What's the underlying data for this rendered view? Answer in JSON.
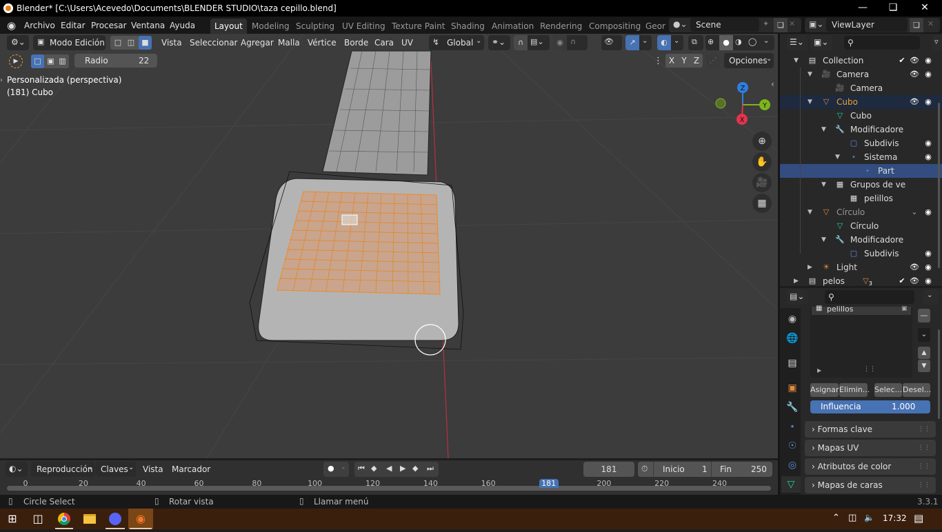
{
  "window": {
    "title": "Blender* [C:\\Users\\Acevedo\\Documents\\BLENDER STUDIO\\taza cepillo.blend]",
    "controls": [
      "minimize",
      "maximize",
      "close"
    ]
  },
  "menubar": {
    "menus": [
      "Archivo",
      "Editar",
      "Procesar",
      "Ventana",
      "Ayuda"
    ],
    "workspaces": [
      "Layout",
      "Modeling",
      "Sculpting",
      "UV Editing",
      "Texture Paint",
      "Shading",
      "Animation",
      "Rendering",
      "Compositing",
      "Geor"
    ],
    "active_workspace": "Layout",
    "scene": "Scene",
    "view_layer": "ViewLayer"
  },
  "viewport_header": {
    "mode": "Modo Edición",
    "menus": [
      "Vista",
      "Seleccionar",
      "Agregar",
      "Malla",
      "Vértice",
      "Borde",
      "Cara",
      "UV"
    ],
    "orientation": "Global",
    "axes": [
      "X",
      "Y",
      "Z"
    ],
    "options_label": "Opciones"
  },
  "tool_settings": {
    "radius_label": "Radio",
    "radius_value": "22"
  },
  "viewport": {
    "view_name": "Personalizada (perspectiva)",
    "object_info": "(181) Cubo",
    "gizmo_axes": {
      "z": "Z",
      "y": "Y",
      "x": "X"
    },
    "colors": {
      "x": "#e4344c",
      "y": "#7db61b",
      "z": "#2e7fe0",
      "selection": "#f08a24"
    }
  },
  "outliner": {
    "search_placeholder": "",
    "rows": [
      {
        "label": "Collection",
        "icon": "collection-icon",
        "level": 0,
        "expanded": true
      },
      {
        "label": "Camera",
        "icon": "camera-object-icon",
        "level": 1,
        "expanded": true
      },
      {
        "label": "Camera",
        "icon": "camera-data-icon",
        "level": 2
      },
      {
        "label": "Cubo",
        "icon": "mesh-object-icon",
        "level": 1,
        "expanded": true,
        "active": true
      },
      {
        "label": "Cubo",
        "icon": "mesh-data-icon",
        "level": 2
      },
      {
        "label": "Modificadore",
        "icon": "wrench-icon",
        "level": 2,
        "expanded": true
      },
      {
        "label": "Subdivis",
        "icon": "subdivision-icon",
        "level": 3
      },
      {
        "label": "Sistema",
        "icon": "particles-icon",
        "level": 3,
        "expanded": true
      },
      {
        "label": "Part",
        "icon": "particle-settings-icon",
        "level": 4,
        "selected": true
      },
      {
        "label": "Grupos de ve",
        "icon": "vertex-groups-icon",
        "level": 2,
        "expanded": true
      },
      {
        "label": "pelillos",
        "icon": "vertex-group-icon",
        "level": 3
      },
      {
        "label": "Círculo",
        "icon": "mesh-object-icon",
        "level": 1,
        "expanded": true
      },
      {
        "label": "Círculo",
        "icon": "mesh-data-icon",
        "level": 2
      },
      {
        "label": "Modificadore",
        "icon": "wrench-icon",
        "level": 2,
        "expanded": true
      },
      {
        "label": "Subdivis",
        "icon": "subdivision-icon",
        "level": 3
      },
      {
        "label": "Light",
        "icon": "light-icon",
        "level": 1,
        "expanded": false
      },
      {
        "label": "pelos",
        "icon": "collection-icon",
        "level": 0,
        "expanded": false,
        "badge": "3"
      }
    ]
  },
  "properties": {
    "vertex_group": "pelillos",
    "buttons": [
      "Asignar",
      "Elimin...",
      "Selec...",
      "Desel..."
    ],
    "influence_label": "Influencia",
    "influence_value": "1.000",
    "panels": [
      "Formas clave",
      "Mapas UV",
      "Atributos de color",
      "Mapas de caras"
    ]
  },
  "timeline": {
    "menus": [
      "Reproducción",
      "Claves",
      "Vista",
      "Marcador"
    ],
    "current_frame": "181",
    "start_label": "Inicio",
    "start_value": "1",
    "end_label": "Fin",
    "end_value": "250",
    "ticks": [
      "0",
      "20",
      "40",
      "60",
      "80",
      "100",
      "120",
      "140",
      "160",
      "181",
      "200",
      "220",
      "240"
    ]
  },
  "statusbar": {
    "left": "Circle Select",
    "middle": "Rotar vista",
    "right": "Llamar menú",
    "version": "3.3.1"
  },
  "taskbar": {
    "apps": [
      "windows-start",
      "task-view",
      "chrome",
      "file-explorer",
      "discord",
      "blender"
    ],
    "time": "17:32"
  }
}
